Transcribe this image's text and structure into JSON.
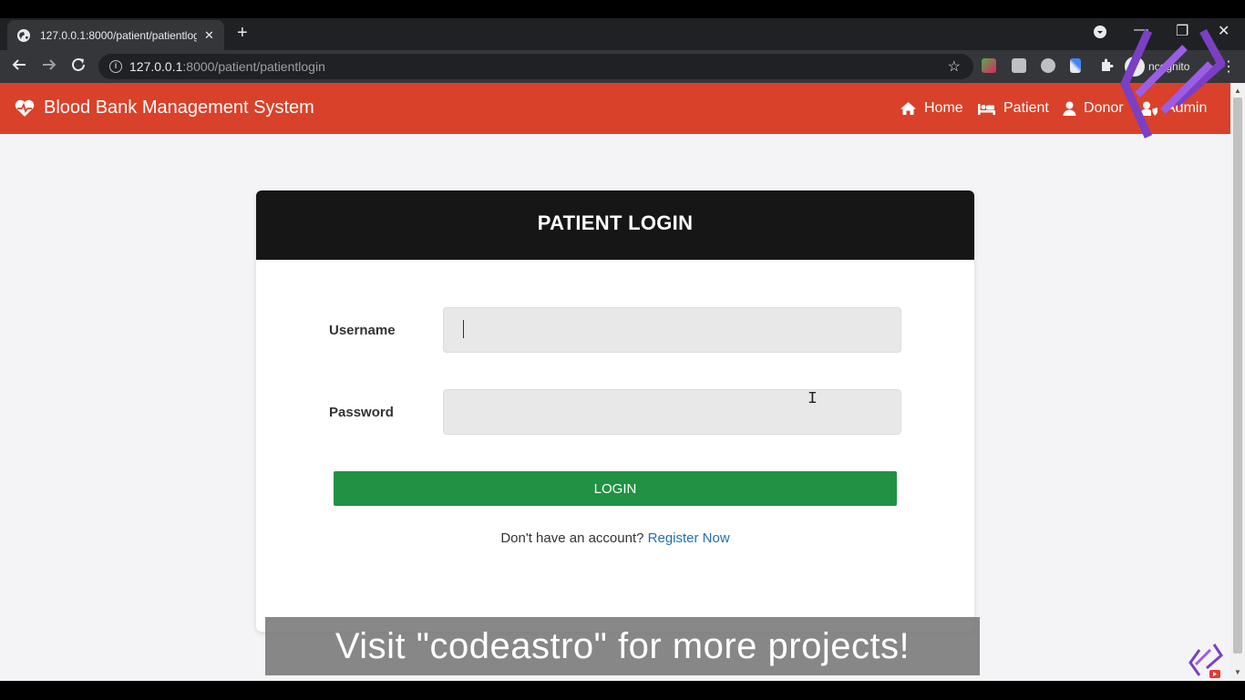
{
  "browser": {
    "tab_title": "127.0.0.1:8000/patient/patientlog",
    "tab_close": "✕",
    "new_tab": "+",
    "url_host": "127.0.0.1",
    "url_path": ":8000/patient/patientlogin",
    "incognito_label": "ncognito",
    "window_controls": {
      "minimize": "—",
      "restore": "❐",
      "close": "✕"
    }
  },
  "navbar": {
    "brand": "Blood Bank Management System",
    "links": [
      {
        "label": "Home",
        "icon": "home-icon"
      },
      {
        "label": "Patient",
        "icon": "bed-icon"
      },
      {
        "label": "Donor",
        "icon": "user-icon"
      },
      {
        "label": "Admin",
        "icon": "user-shield-icon"
      }
    ],
    "color": "#d9412a"
  },
  "login_card": {
    "title": "PATIENT LOGIN",
    "username_label": "Username",
    "password_label": "Password",
    "username_value": "",
    "password_value": "",
    "button_label": "LOGIN",
    "signup_prompt": "Don't have an account?",
    "signup_link": "Register Now",
    "button_color": "#219143"
  },
  "overlay": {
    "banner_text": "Visit \"codeastro\" for more projects!"
  }
}
